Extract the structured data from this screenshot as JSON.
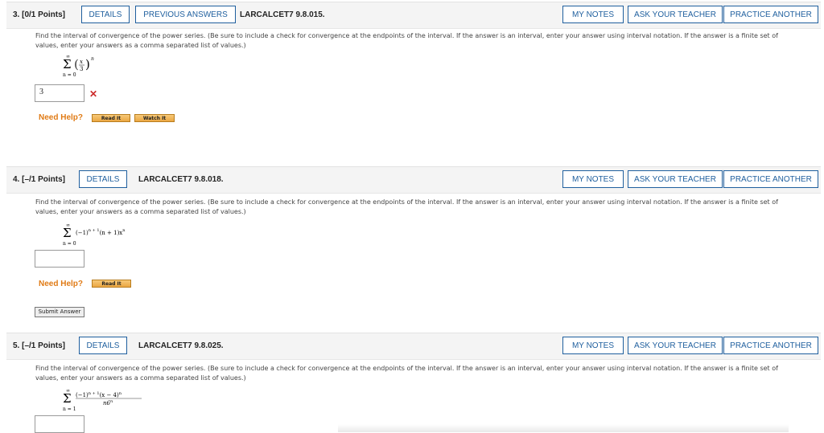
{
  "questions": [
    {
      "num_label": "3. [0/1 Points]",
      "details": "DETAILS",
      "previous": "PREVIOUS ANSWERS",
      "code": "LARCALCET7 9.8.015.",
      "my_notes": "MY NOTES",
      "ask": "ASK YOUR TEACHER",
      "practice": "PRACTICE ANOTHER",
      "prompt": "Find the interval of convergence of the power series. (Be sure to include a check for convergence at the endpoints of the interval. If the answer is an interval, enter your answer using interval notation. If the answer is a finite set of values, enter your answers as a comma separated list of values.)",
      "series_upper": "∞",
      "series_lower": "n = 0",
      "answer_value": "3",
      "status_icon": "wrong-mark",
      "need_help": "Need Help?",
      "help_buttons": [
        "Read It",
        "Watch It"
      ]
    },
    {
      "num_label": "4. [–/1 Points]",
      "details": "DETAILS",
      "code": "LARCALCET7 9.8.018.",
      "my_notes": "MY NOTES",
      "ask": "ASK YOUR TEACHER",
      "practice": "PRACTICE ANOTHER",
      "prompt": "Find the interval of convergence of the power series. (Be sure to include a check for convergence at the endpoints of the interval. If the answer is an interval, enter your answer using interval notation. If the answer is a finite set of values, enter your answers as a comma separated list of values.)",
      "series_upper": "∞",
      "series_lower": "n = 0",
      "answer_value": "",
      "need_help": "Need Help?",
      "help_buttons": [
        "Read It"
      ],
      "submit": "Submit Answer"
    },
    {
      "num_label": "5. [–/1 Points]",
      "details": "DETAILS",
      "code": "LARCALCET7 9.8.025.",
      "my_notes": "MY NOTES",
      "ask": "ASK YOUR TEACHER",
      "practice": "PRACTICE ANOTHER",
      "prompt": "Find the interval of convergence of the power series. (Be sure to include a check for convergence at the endpoints of the interval. If the answer is an interval, enter your answer using interval notation. If the answer is a finite set of values, enter your answers as a comma separated list of values.)",
      "series_upper": "∞",
      "series_lower": "n = 1"
    }
  ],
  "colors": {
    "accent": "#1f5f9e",
    "help": "#e07b16",
    "wrong": "#cc2b2b"
  }
}
